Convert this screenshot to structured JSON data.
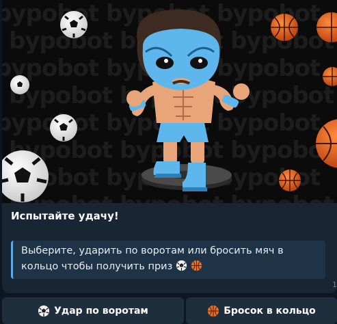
{
  "banner": {
    "watermark": "bypobot",
    "accent_color": "#5eb7ec"
  },
  "message": {
    "title": "Испытайте удачу!",
    "quote_text": "Выберите, ударить по воротам или бросить мяч в кольцо чтобы получить приз",
    "time": "1"
  },
  "keyboard": {
    "buttons": [
      {
        "label": "Удар по воротам",
        "icon": "soccer-ball-icon"
      },
      {
        "label": "Бросок в кольцо",
        "icon": "basketball-icon"
      }
    ]
  },
  "colors": {
    "background": "#0e1621",
    "bubble": "#182533",
    "quote_bar": "#5eabe5",
    "button": "#1f2e3d"
  }
}
